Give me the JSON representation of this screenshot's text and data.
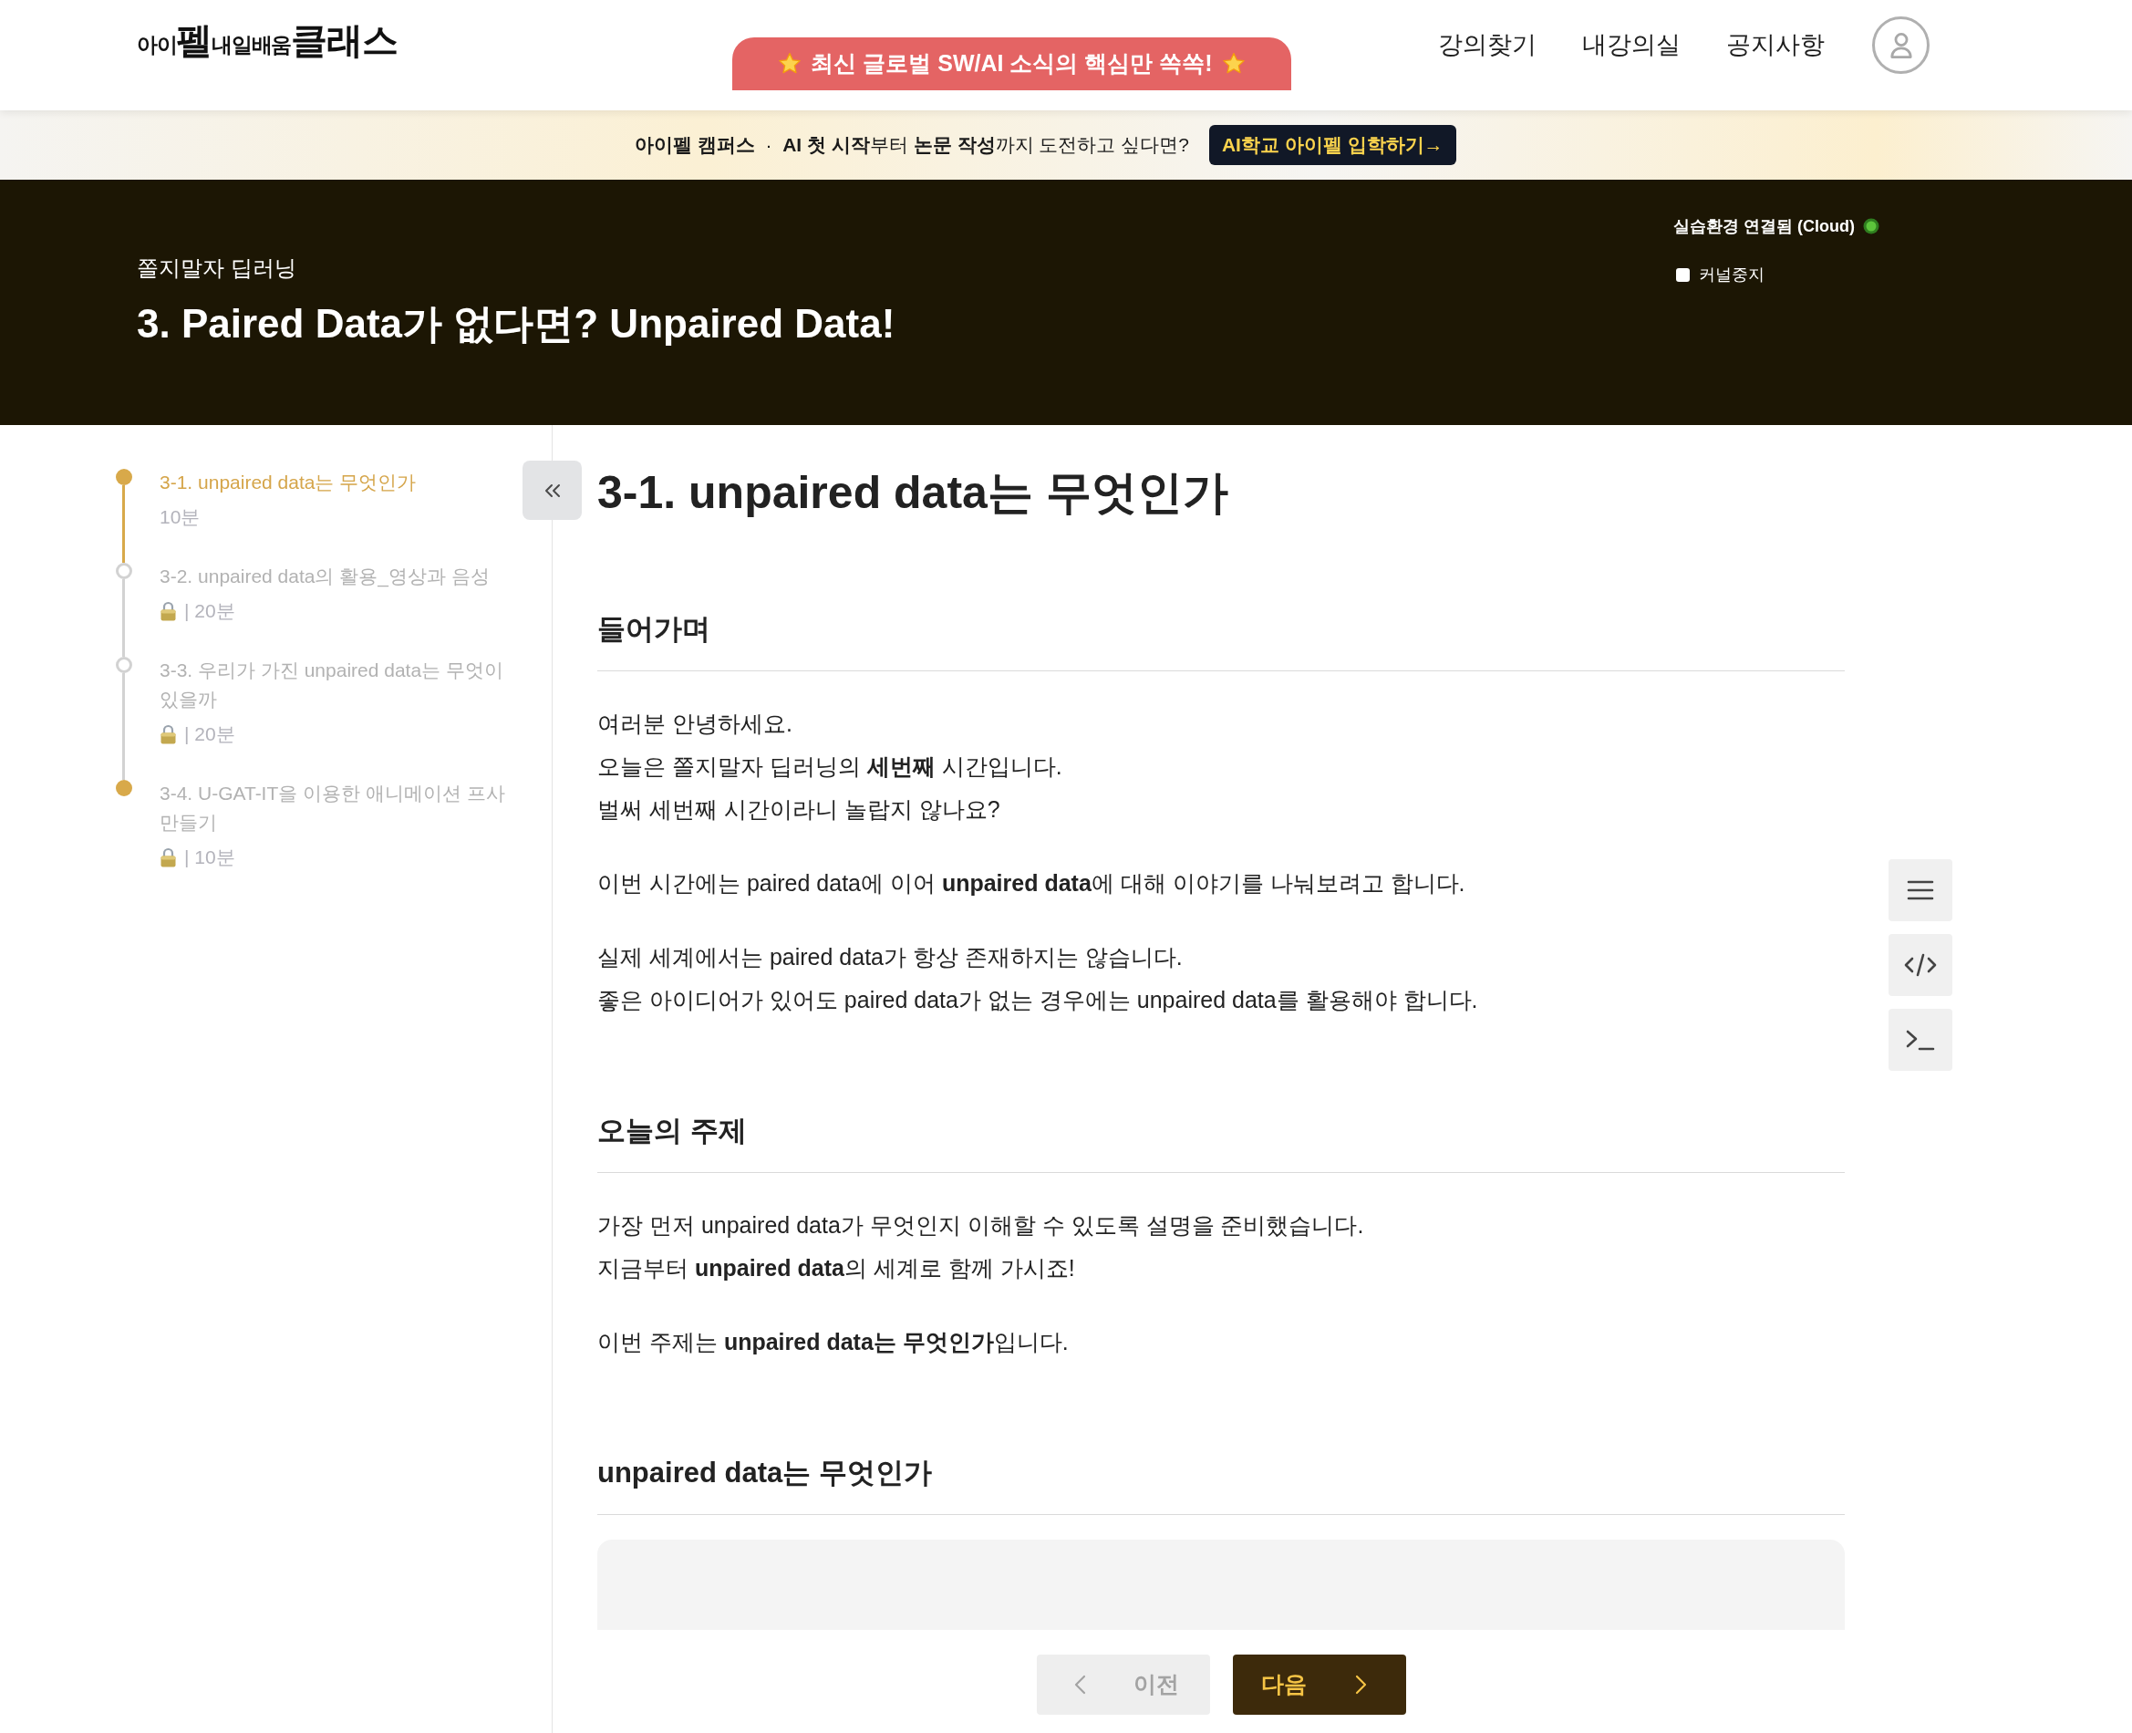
{
  "header": {
    "logo": [
      {
        "text": "아이",
        "kind": "small"
      },
      {
        "text": "펠",
        "kind": "large"
      },
      {
        "text": "내일배움",
        "kind": "small"
      },
      {
        "text": "클래스",
        "kind": "large"
      }
    ],
    "promo": "최신 글로벌 SW/AI 소식의 핵심만 쏙쏙!",
    "nav": [
      "강의찾기",
      "내강의실",
      "공지사항"
    ]
  },
  "notice_bar": {
    "text": "**아이펠 캠퍼스**  ·  **AI 첫 시작**부터 **논문 작성**까지 도전하고 싶다면?",
    "button": "AI학교 아이펠 입학하기→"
  },
  "course_banner": {
    "course": "쫄지말자 딥러닝",
    "title": "3. Paired Data가 없다면? Unpaired Data!",
    "status": {
      "label": "실습환경 연결됨 (Cloud)",
      "connected": true
    },
    "kernel_stop": {
      "label": "커널중지",
      "checked": false
    }
  },
  "sidebar": {
    "items": [
      {
        "title": "3-1. unpaired data는 무엇인가",
        "meta": "10분",
        "selected": true,
        "completed": true,
        "locked": false
      },
      {
        "title": "3-2. unpaired data의 활용_영상과 음성",
        "meta": "| 20분",
        "selected": false,
        "completed": false,
        "locked": true
      },
      {
        "title": "3-3. 우리가 가진 unpaired data는 무엇이 있을까",
        "meta": "| 20분",
        "selected": false,
        "completed": false,
        "locked": true
      },
      {
        "title": "3-4. U-GAT-IT을 이용한 애니메이션 프사 만들기",
        "meta": "| 10분",
        "selected": false,
        "completed": true,
        "locked": true
      }
    ]
  },
  "lesson": {
    "title": "3-1. unpaired data는 무엇인가",
    "sections": [
      {
        "heading": "들어가며",
        "blocks": [
          {
            "kind": "paragraph",
            "lines": [
              "여러분 안녕하세요.",
              "오늘은 쫄지말자 딥러닝의 **세번째** 시간입니다.",
              "벌써 세번째 시간이라니 놀랍지 않나요?"
            ]
          },
          {
            "kind": "paragraph",
            "lines": [
              "이번 시간에는 paired data에 이어 **unpaired data**에 대해 이야기를 나눠보려고 합니다."
            ]
          },
          {
            "kind": "paragraph",
            "lines": [
              "실제 세계에서는 paired data가 항상 존재하지는 않습니다.",
              "좋은 아이디어가 있어도 paired data가 없는 경우에는 unpaired data를 활용해야 합니다."
            ]
          }
        ]
      },
      {
        "heading": "오늘의 주제",
        "blocks": [
          {
            "kind": "paragraph",
            "lines": [
              "가장 먼저 unpaired data가 무엇인지 이해할 수 있도록 설명을 준비했습니다.",
              "지금부터 **unpaired data**의 세계로 함께 가시죠!"
            ]
          },
          {
            "kind": "paragraph",
            "lines": [
              "이번 주제는 **unpaired data는 무엇인가**입니다."
            ]
          }
        ]
      },
      {
        "heading": "unpaired data는 무엇인가",
        "blocks": [
          {
            "kind": "panel"
          }
        ]
      }
    ]
  },
  "pager": [
    {
      "kind": "prev",
      "label": "이전",
      "disabled": true
    },
    {
      "kind": "next",
      "label": "다음",
      "disabled": false
    }
  ]
}
